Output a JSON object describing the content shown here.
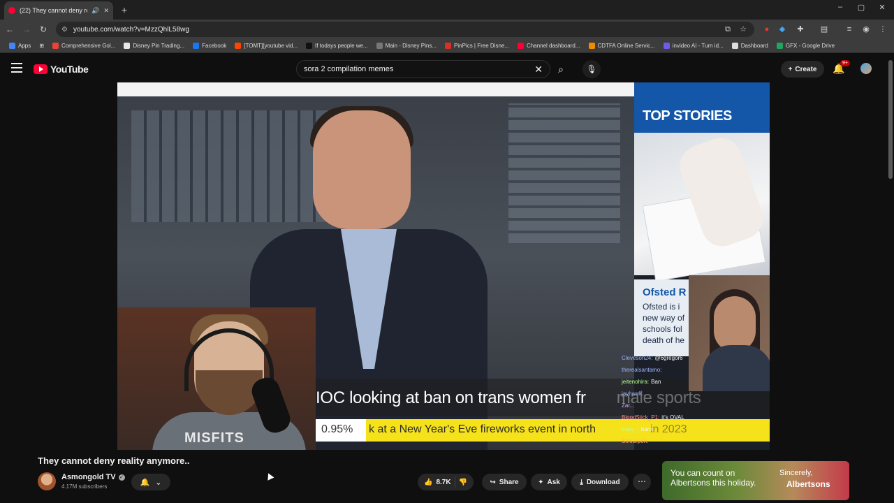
{
  "browser": {
    "tab_title": "(22) They cannot deny reali",
    "url": "youtube.com/watch?v=MzzQhlL58wg",
    "bookmarks": [
      {
        "label": "Apps",
        "color": "#4285f4"
      },
      {
        "label": "Comprehensive Gol...",
        "color": "#ea4335"
      },
      {
        "label": "Disney Pin Trading...",
        "color": "#e8e8e8"
      },
      {
        "label": "Facebook",
        "color": "#1877f2"
      },
      {
        "label": "[TOMT][youtube vid...",
        "color": "#ff4500"
      },
      {
        "label": "If todays people we...",
        "color": "#111111"
      },
      {
        "label": "Main - Disney Pins...",
        "color": "#777777"
      },
      {
        "label": "PinPics | Free Disne...",
        "color": "#d93025"
      },
      {
        "label": "Channel dashboard...",
        "color": "#ff0033"
      },
      {
        "label": "CDTFA Online Servic...",
        "color": "#f28b00"
      },
      {
        "label": "invideo AI - Turn id...",
        "color": "#6c5ce7"
      },
      {
        "label": "Dashboard",
        "color": "#dddddd"
      },
      {
        "label": "GFX - Google Drive",
        "color": "#1fa463"
      }
    ]
  },
  "youtube": {
    "logo_text": "YouTube",
    "search_query": "sora 2 compilation memes",
    "create_label": "Create",
    "notif_count": "9+"
  },
  "video": {
    "top_stories": "TOP STORIES",
    "ofsted_head": "Ofsted R",
    "ofsted_body": [
      "Ofsted is i",
      "new way of",
      "schools fol",
      "death of he"
    ],
    "headline": "IOC looking at ban on trans women fr",
    "headline_tail": "male sports",
    "crawl_pct": "0.95%",
    "crawl_text": "k at a New Year's Eve fireworks event in north",
    "crawl_year": "in 2023",
    "crawl_break": "BREA",
    "shirt_text": "MISFITS",
    "chat": [
      {
        "user": "Cleveson24:",
        "msg": "@6gregor6",
        "cls": "u1"
      },
      {
        "user": "therealsantamo:",
        "msg": "",
        "cls": "u1"
      },
      {
        "user": "jeitenohira:",
        "msg": "Ban",
        "cls": "u3"
      },
      {
        "user": "jayhawk...",
        "msg": "",
        "cls": "u1"
      },
      {
        "user": "Zar...",
        "msg": "",
        "cls": "u4"
      },
      {
        "user": "BloodStick_P1:",
        "msg": "it's OVAL",
        "cls": "u2"
      },
      {
        "user": "inksy_:",
        "msg": "bann",
        "cls": "u3"
      },
      {
        "user": "Schlurpoh:",
        "msg": "",
        "cls": "u5"
      }
    ]
  },
  "below": {
    "title": "They cannot deny reality anymore..",
    "channel": "Asmongold TV",
    "subs": "4.17M subscribers",
    "likes": "8.7K",
    "share": "Share",
    "ask": "Ask",
    "download": "Download",
    "ad_line1": "You can count on Albertsons this holiday.",
    "ad_line2": "Sincerely,",
    "ad_brand": "Albertsons"
  }
}
